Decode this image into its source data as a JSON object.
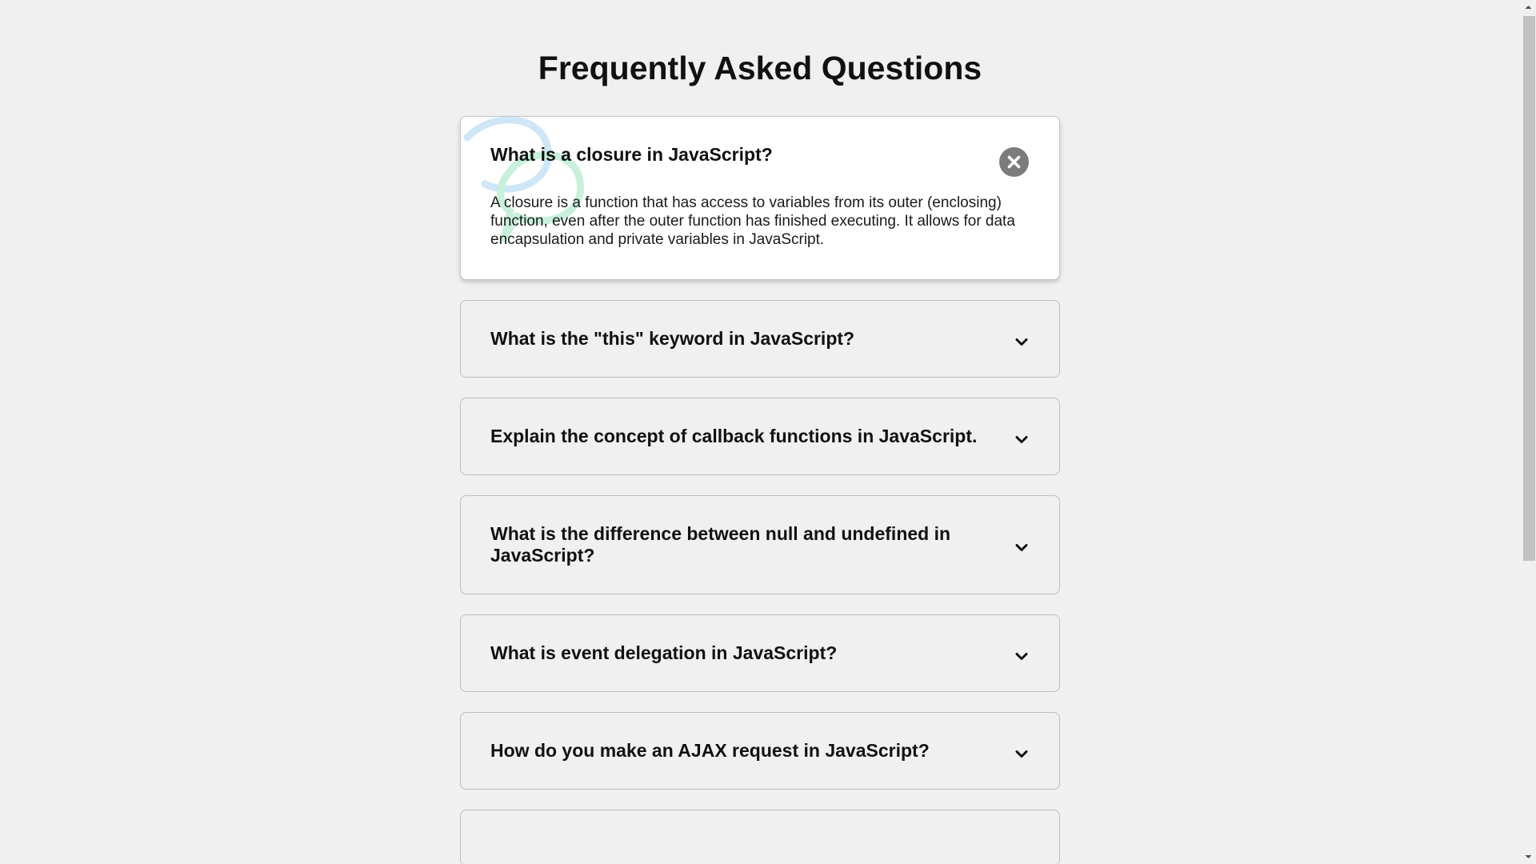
{
  "page": {
    "title": "Frequently Asked Questions"
  },
  "faq": {
    "items": [
      {
        "question": "What is a closure in JavaScript?",
        "answer": "A closure is a function that has access to variables from its outer (enclosing) function, even after the outer function has finished executing. It allows for data encapsulation and private variables in JavaScript.",
        "open": true
      },
      {
        "question": "What is the \"this\" keyword in JavaScript?",
        "open": false
      },
      {
        "question": "Explain the concept of callback functions in JavaScript.",
        "open": false
      },
      {
        "question": "What is the difference between null and undefined in JavaScript?",
        "open": false
      },
      {
        "question": "What is event delegation in JavaScript?",
        "open": false
      },
      {
        "question": "How do you make an AJAX request in JavaScript?",
        "open": false
      },
      {
        "question": "",
        "open": false
      }
    ]
  },
  "icons": {
    "close": "close-icon",
    "expand": "chevron-down-icon",
    "decoration": "chat-bubbles-icon"
  },
  "colors": {
    "page_background": "#f0f0f0",
    "card_open_background": "#ffffff",
    "card_border": "#bdbdbd",
    "close_button": "#7c7c7c",
    "bubble_blue": "#cfe6f7",
    "bubble_green": "#c8f0dc"
  }
}
